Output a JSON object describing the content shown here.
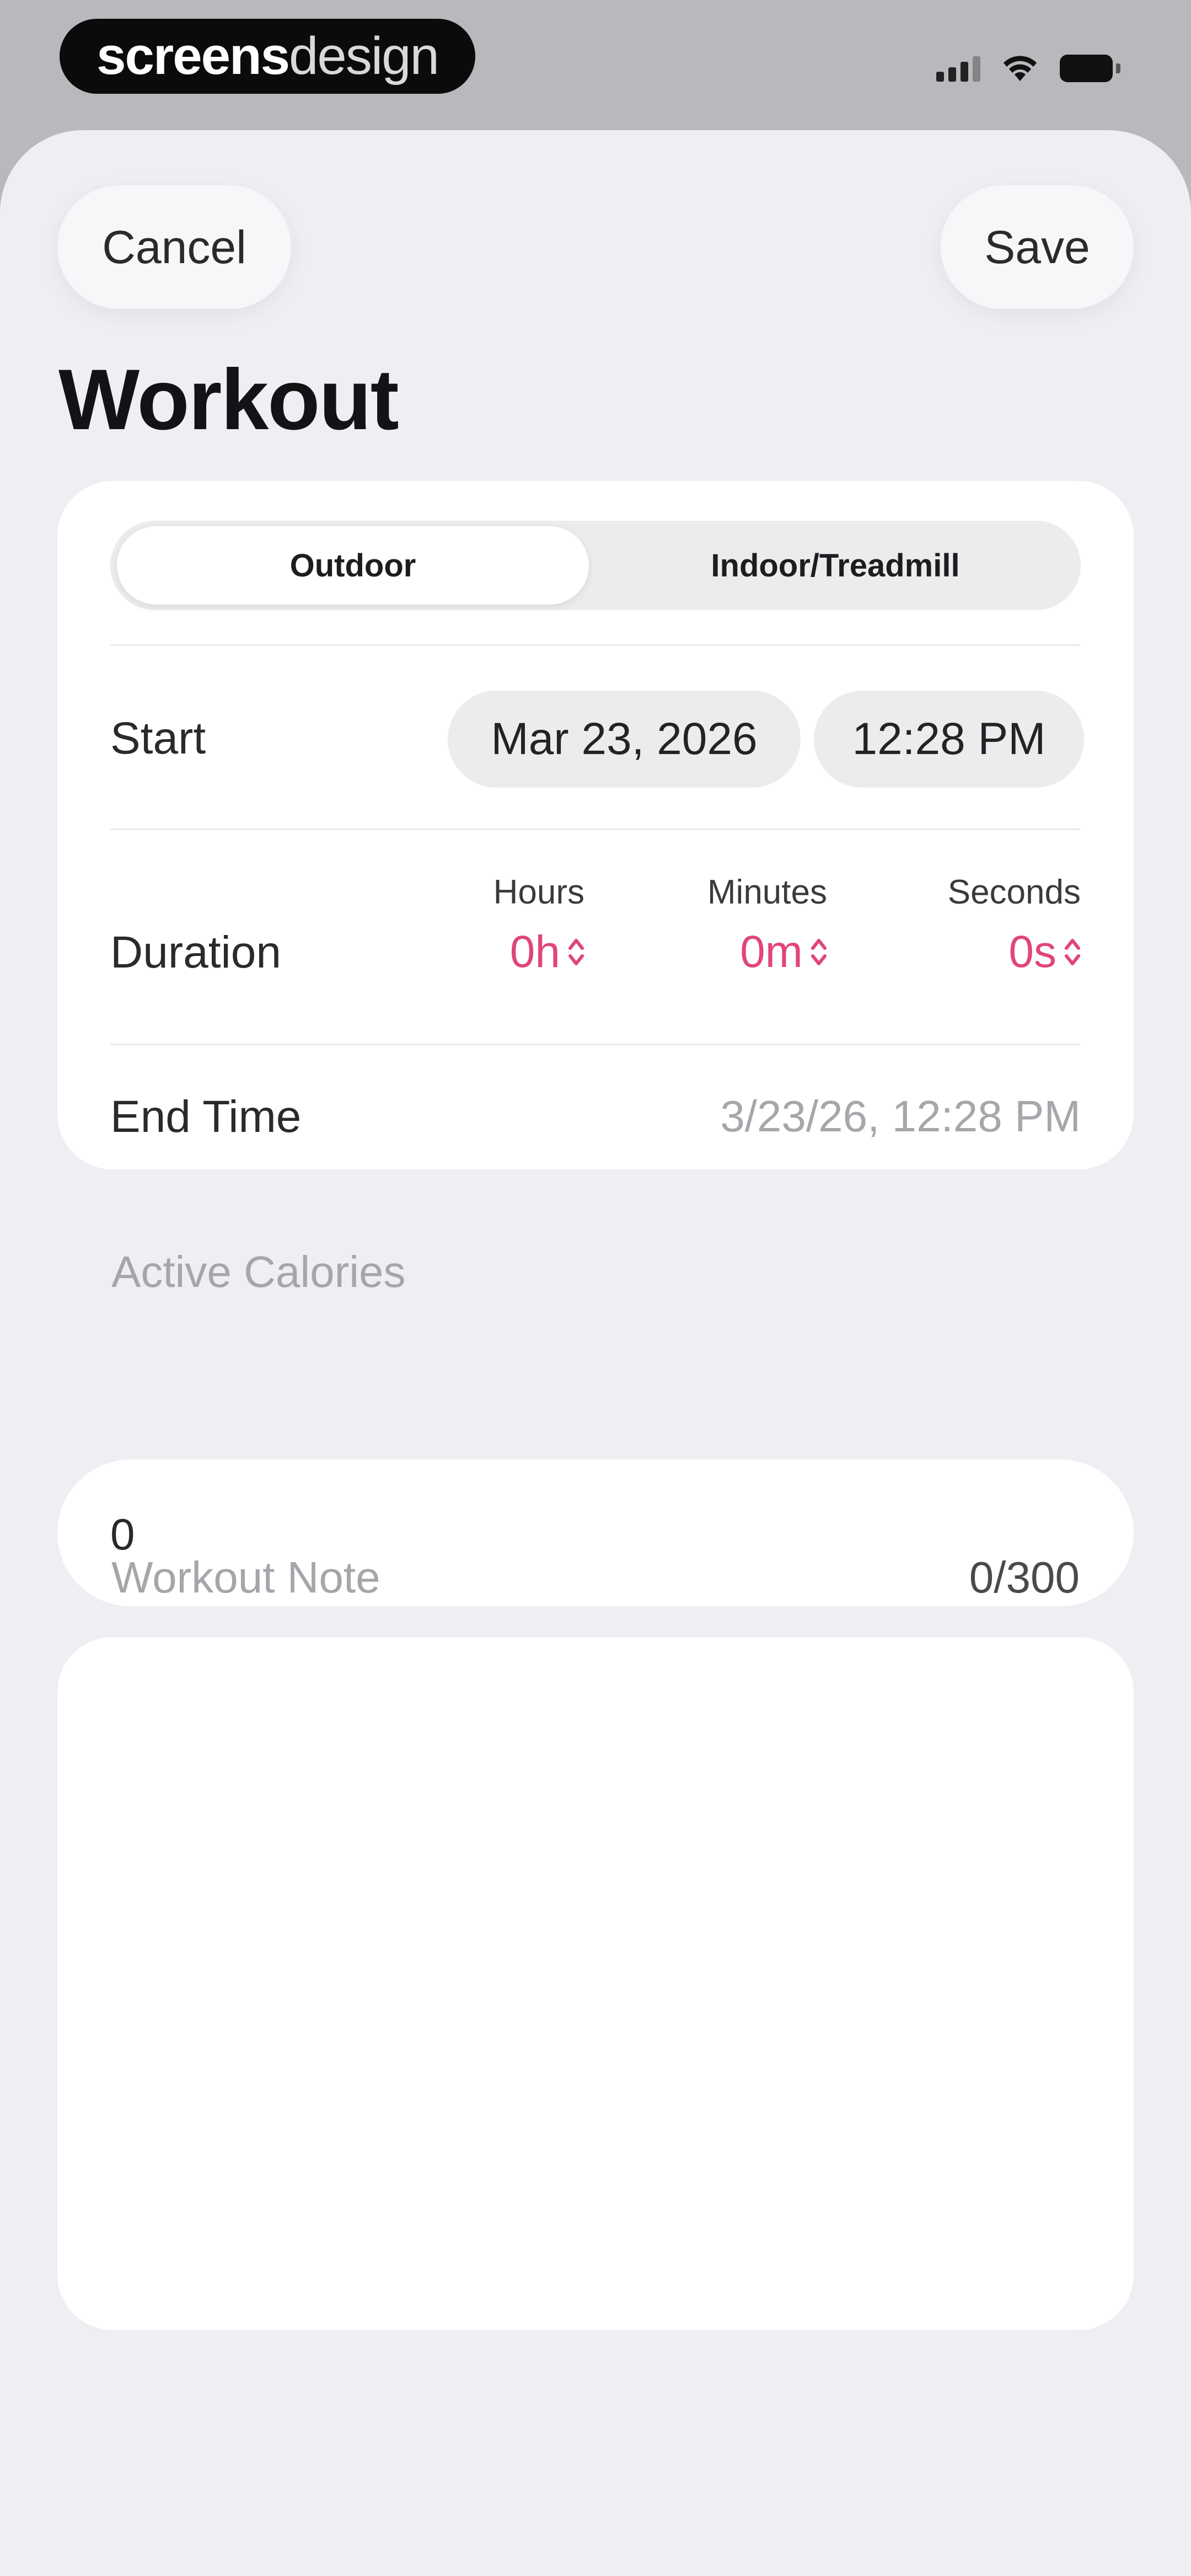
{
  "status_bar": {
    "brand_bold": "screens",
    "brand_light": "design",
    "icons": [
      "cellular-signal-icon",
      "wifi-icon",
      "battery-icon"
    ]
  },
  "nav": {
    "cancel_label": "Cancel",
    "save_label": "Save"
  },
  "title": "Workout",
  "workout_type": {
    "options": [
      "Outdoor",
      "Indoor/Treadmill"
    ],
    "selected": "Outdoor"
  },
  "start": {
    "label": "Start",
    "date": "Mar 23, 2026",
    "time": "12:28 PM"
  },
  "duration": {
    "label": "Duration",
    "hours_label": "Hours",
    "hours_value": "0h",
    "minutes_label": "Minutes",
    "minutes_value": "0m",
    "seconds_label": "Seconds",
    "seconds_value": "0s"
  },
  "end_time": {
    "label": "End Time",
    "value": "3/23/26, 12:28 PM"
  },
  "active_calories": {
    "label": "Active Calories",
    "value": "0"
  },
  "workout_note": {
    "label": "Workout Note",
    "counter": "0/300",
    "value": ""
  },
  "colors": {
    "accent": "#e0457b",
    "sheet_background": "#efeef3",
    "card_background": "#ffffff",
    "secondary_text": "#a6a5aa"
  }
}
